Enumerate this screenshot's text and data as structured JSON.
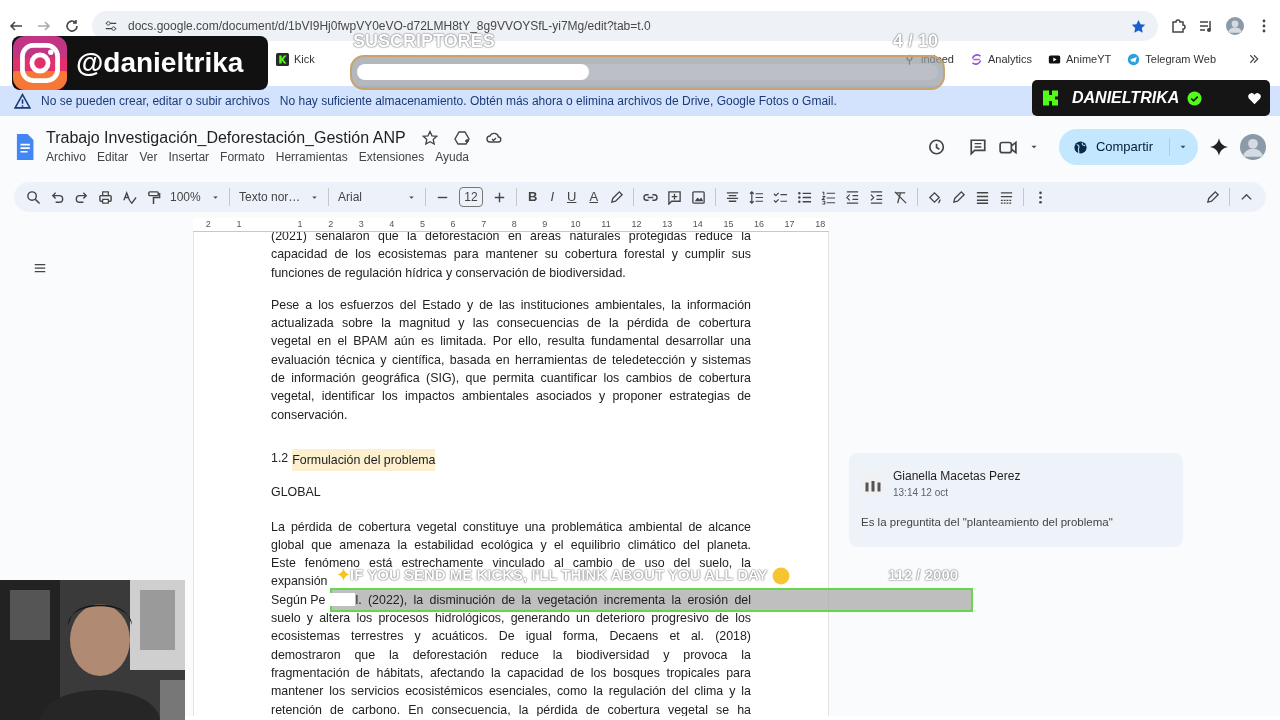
{
  "browser": {
    "url": "docs.google.com/document/d/1bVI9Hj0fwpVY0eVO-d72LMH8tY_8g9VVOYSfL-yi7Mg/edit?tab=t.0",
    "bookmarks": [
      {
        "label": "Kick"
      },
      {
        "label": "indeed"
      },
      {
        "label": "Analytics"
      },
      {
        "label": "AnimeYT"
      },
      {
        "label": "Telegram Web"
      }
    ]
  },
  "banner": {
    "title": "No se pueden crear, editar o subir archivos",
    "message": "No hay suficiente almacenamiento. Obtén más ahora o elimina archivos de Drive, Google Fotos o Gmail."
  },
  "document": {
    "title": "Trabajo Investigación_Deforestación_Gestión ANP",
    "menu": [
      "Archivo",
      "Editar",
      "Ver",
      "Insertar",
      "Formato",
      "Herramientas",
      "Extensiones",
      "Ayuda"
    ],
    "share_label": "Compartir"
  },
  "toolbar": {
    "zoom": "100%",
    "style": "Texto nor…",
    "font": "Arial",
    "size": "12",
    "format": [
      "B",
      "I",
      "U",
      "A"
    ]
  },
  "ruler": [
    "2",
    "1",
    "1",
    "2",
    "3",
    "4",
    "5",
    "6",
    "7",
    "8",
    "9",
    "10",
    "11",
    "12",
    "13",
    "14",
    "15",
    "16",
    "17",
    "18"
  ],
  "body": [
    {
      "kind": "paragraph",
      "lines": [
        "(2021) señalaron que la deforestación en áreas naturales protegidas reduce la",
        "capacidad de los ecosistemas para mantener su cobertura forestal y cumplir sus",
        "funciones de regulación hídrica y conservación de biodiversidad."
      ]
    },
    {
      "kind": "paragraph",
      "lines": [
        "Pese a los esfuerzos del Estado y de las instituciones ambientales, la información",
        "actualizada sobre la magnitud y las consecuencias de la pérdida de cobertura",
        "vegetal en el BPAM aún es limitada. Por ello, resulta fundamental desarrollar una",
        "evaluación técnica y científica, basada en herramientas de teledetección y sistemas",
        "de información geográfica (SIG), que permita cuantificar los cambios de cobertura",
        "vegetal, identificar los impactos ambientales asociados y proponer estrategias de",
        "conservación."
      ]
    },
    {
      "kind": "heading",
      "number": "1.2",
      "text": "Formulación del problema",
      "commented": true
    },
    {
      "kind": "label",
      "text": "GLOBAL"
    },
    {
      "kind": "paragraph",
      "cut_off": true,
      "lines": [
        "La pérdida de cobertura vegetal constituye una problemática ambiental de alcance",
        "global que amenaza la estabilidad ecológica y el equilibrio climático del planeta.",
        "Este fenómeno está estrechamente vinculado al cambio de uso del suelo, la",
        {
          "before": "expansión"
        },
        {
          "before": "Según Pe",
          "after": "l. (2022), la disminución de la vegetación incrementa la erosión del"
        },
        "suelo y altera los procesos hidrológicos, generando un deterioro progresivo de los",
        "ecosistemas terrestres y acuáticos. De igual forma, Decaens et al. (2018)",
        "demostraron que la deforestación reduce la biodiversidad y provoca la",
        "fragmentación de hábitats, afectando la capacidad de los bosques tropicales para",
        "mantener los servicios ecosistémicos esenciales, como la regulación del clima y la",
        "retención de carbono. En consecuencia, la pérdida de cobertura vegetal se ha"
      ]
    }
  ],
  "comment": {
    "author": "Gianella Macetas Perez",
    "time": "13:14 12 oct",
    "text": "Es la preguntita del \"planteamiento del problema\""
  },
  "overlays": {
    "instagram_handle": "@danieltrika",
    "kick_name": "DANIELTRIKA",
    "sub_goal": {
      "title": "SUSCRIPTORES",
      "count": "4 / 10",
      "level": 0.4
    },
    "kick_goal": {
      "title": "IF YOU SEND ME KICKS, I'LL THINK ABOUT YOU ALL DAY",
      "count": "112 / 2000"
    }
  }
}
